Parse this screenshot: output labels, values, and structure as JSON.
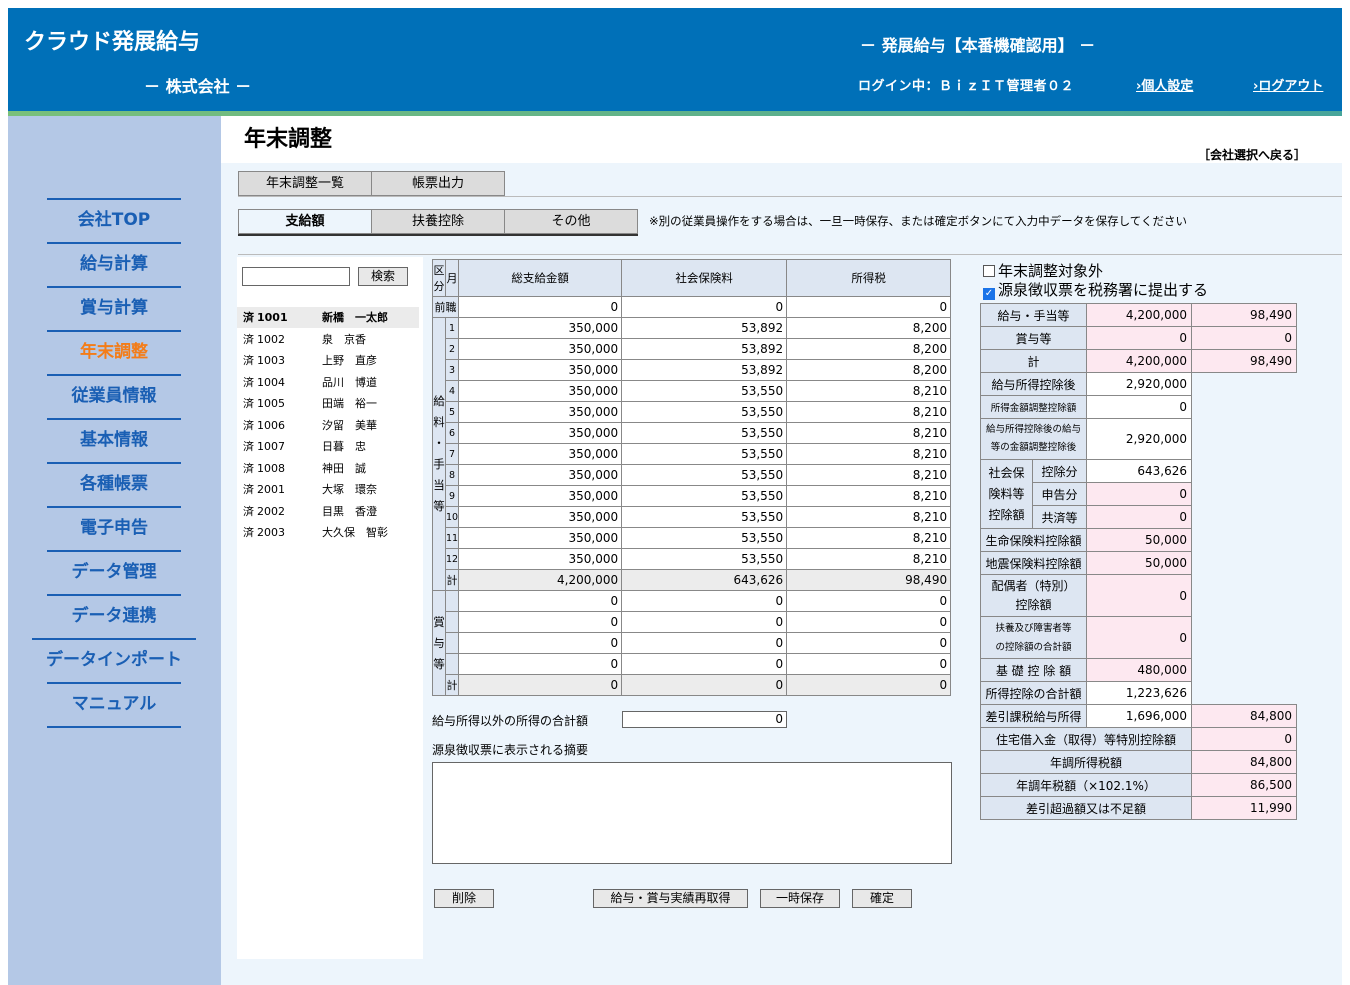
{
  "header": {
    "logo": "クラウド発展給与",
    "company": "－ 株式会社 －",
    "title": "－ 発展給与【本番機確認用】 －",
    "login": "ログイン中：ＢｉｚＩＴ管理者０２",
    "personal_settings": "›個人設定",
    "logout": "›ログアウト"
  },
  "nav": [
    "会社TOP",
    "給与計算",
    "賞与計算",
    "年末調整",
    "従業員情報",
    "基本情報",
    "各種帳票",
    "電子申告",
    "データ管理",
    "データ連携",
    "データインポート",
    "マニュアル"
  ],
  "page": {
    "title": "年末調整",
    "back": "［会社選択へ戻る］",
    "tabs_top": [
      "年末調整一覧",
      "帳票出力"
    ],
    "tabs_sub": [
      "支給額",
      "扶養控除",
      "その他"
    ],
    "notice": "※別の従業員操作をする場合は、一旦一時保存、または確定ボタンにて入力中データを保存してください"
  },
  "search": {
    "button": "検索",
    "value": ""
  },
  "employees": [
    {
      "status": "済",
      "code": "1001",
      "name": "新橋　一太郎"
    },
    {
      "status": "済",
      "code": "1002",
      "name": "泉　京香"
    },
    {
      "status": "済",
      "code": "1003",
      "name": "上野　直彦"
    },
    {
      "status": "済",
      "code": "1004",
      "name": "品川　博道"
    },
    {
      "status": "済",
      "code": "1005",
      "name": "田端　裕一"
    },
    {
      "status": "済",
      "code": "1006",
      "name": "汐留　美華"
    },
    {
      "status": "済",
      "code": "1007",
      "name": "日暮　忠"
    },
    {
      "status": "済",
      "code": "1008",
      "name": "神田　誠"
    },
    {
      "status": "済",
      "code": "2001",
      "name": "大塚　環奈"
    },
    {
      "status": "済",
      "code": "2002",
      "name": "目黒　香澄"
    },
    {
      "status": "済",
      "code": "2003",
      "name": "大久保　智彰"
    }
  ],
  "grid": {
    "headers": {
      "kubun": "区分",
      "month": "月",
      "total": "総支給金額",
      "social": "社会保険料",
      "tax": "所得税"
    },
    "prev_label": "前職",
    "prev": [
      "0",
      "0",
      "0"
    ],
    "salary_label": [
      "給",
      "料",
      "・",
      "手",
      "当",
      "等"
    ],
    "salary": [
      [
        "1",
        "350,000",
        "53,892",
        "8,200"
      ],
      [
        "2",
        "350,000",
        "53,892",
        "8,200"
      ],
      [
        "3",
        "350,000",
        "53,892",
        "8,200"
      ],
      [
        "4",
        "350,000",
        "53,550",
        "8,210"
      ],
      [
        "5",
        "350,000",
        "53,550",
        "8,210"
      ],
      [
        "6",
        "350,000",
        "53,550",
        "8,210"
      ],
      [
        "7",
        "350,000",
        "53,550",
        "8,210"
      ],
      [
        "8",
        "350,000",
        "53,550",
        "8,210"
      ],
      [
        "9",
        "350,000",
        "53,550",
        "8,210"
      ],
      [
        "10",
        "350,000",
        "53,550",
        "8,210"
      ],
      [
        "11",
        "350,000",
        "53,550",
        "8,210"
      ],
      [
        "12",
        "350,000",
        "53,550",
        "8,210"
      ]
    ],
    "sum_label": "計",
    "salary_sum": [
      "4,200,000",
      "643,626",
      "98,490"
    ],
    "bonus_label": [
      "賞",
      "与",
      "等"
    ],
    "bonus": [
      [
        "0",
        "0",
        "0"
      ],
      [
        "0",
        "0",
        "0"
      ],
      [
        "0",
        "0",
        "0"
      ],
      [
        "0",
        "0",
        "0"
      ]
    ],
    "bonus_sum": [
      "0",
      "0",
      "0"
    ]
  },
  "other": {
    "label": "給与所得以外の所得の合計額",
    "value": "0",
    "memo_label": "源泉徴収票に表示される摘要"
  },
  "buttons": {
    "delete": "削除",
    "refetch": "給与・賞与実績再取得",
    "temp_save": "一時保存",
    "confirm": "確定"
  },
  "checks": {
    "exclude": "年末調整対象外",
    "submit": "源泉徴収票を税務署に提出する"
  },
  "summary": {
    "kyuyo": {
      "label": "給与・手当等",
      "amount": "4,200,000",
      "tax": "98,490"
    },
    "shoyo": {
      "label": "賞与等",
      "amount": "0",
      "tax": "0"
    },
    "kei": {
      "label": "計",
      "amount": "4,200,000",
      "tax": "98,490"
    },
    "after_deduction": {
      "label": "給与所得控除後",
      "value": "2,920,000"
    },
    "income_adjust": {
      "label": "所得金額調整控除額",
      "value": "0"
    },
    "after_adjust": {
      "label1": "給与所得控除後の給与",
      "label2": "等の金額調整控除後",
      "value": "2,920,000"
    },
    "social": {
      "group": [
        "社会保",
        "険料等",
        "控除額"
      ],
      "k1": "控除分",
      "v1": "643,626",
      "k2": "申告分",
      "v2": "0",
      "k3": "共済等",
      "v3": "0"
    },
    "life": {
      "label": "生命保険料控除額",
      "value": "50,000"
    },
    "quake": {
      "label": "地震保険料控除額",
      "value": "50,000"
    },
    "spouse": {
      "label1": "配偶者（特別）",
      "label2": "控除額",
      "value": "0"
    },
    "dependents": {
      "label1": "扶養及び障害者等",
      "label2": "の控除額の合計額",
      "value": "0"
    },
    "basic": {
      "label": "基 礎 控 除 額",
      "value": "480,000"
    },
    "total_deduction": {
      "label": "所得控除の合計額",
      "value": "1,223,626"
    },
    "taxable": {
      "label": "差引課税給与所得",
      "value": "1,696,000",
      "tax": "84,800"
    },
    "housing": {
      "label": "住宅借入金（取得）等特別控除額",
      "value": "0"
    },
    "annual_tax": {
      "label": "年調所得税額",
      "value": "84,800"
    },
    "annual_tax2": {
      "label": "年調年税額（×102.1%）",
      "value": "86,500"
    },
    "difference": {
      "label": "差引超過額又は不足額",
      "value": "11,990"
    }
  }
}
